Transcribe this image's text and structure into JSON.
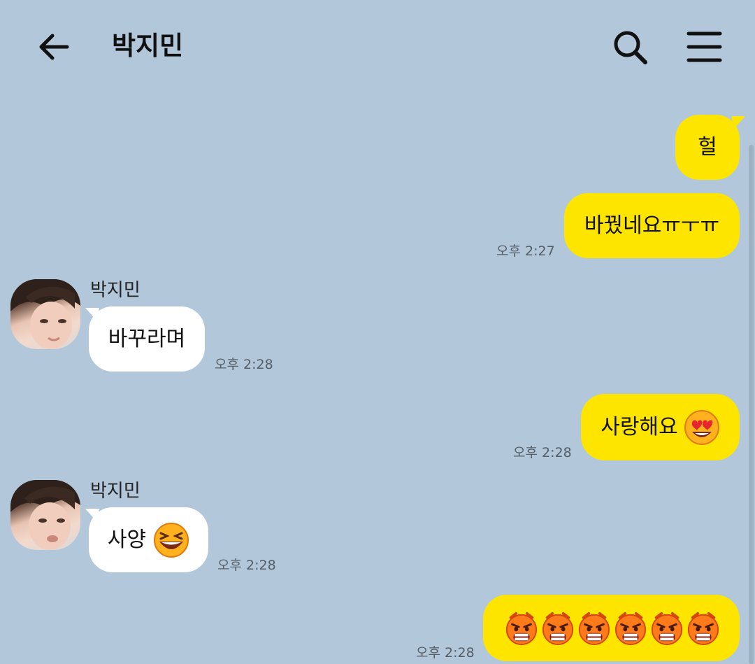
{
  "header": {
    "title": "박지민",
    "back_icon": "arrow-left-icon",
    "search_icon": "search-icon",
    "menu_icon": "menu-icon"
  },
  "colors": {
    "background": "#b2c7da",
    "my_bubble": "#fee500",
    "their_bubble": "#ffffff"
  },
  "messages": [
    {
      "from": "me",
      "text": "헐"
    },
    {
      "from": "me",
      "text": "바꿨네요ㅠㅜㅠ",
      "time": "오후 2:27"
    },
    {
      "from": "them",
      "sender": "박지민",
      "text": "바꾸라며",
      "time": "오후 2:28"
    },
    {
      "from": "me",
      "text": "사랑해요",
      "emoji": "heart-eyes-emoji",
      "time": "오후 2:28"
    },
    {
      "from": "them",
      "sender": "박지민",
      "text": "사양",
      "emoji": "grinning-squint-emoji",
      "time": "오후 2:28"
    },
    {
      "from": "me",
      "text": "",
      "emoji": "angry-face-emoji",
      "emoji_count": 6,
      "time": "오후 2:28"
    }
  ]
}
